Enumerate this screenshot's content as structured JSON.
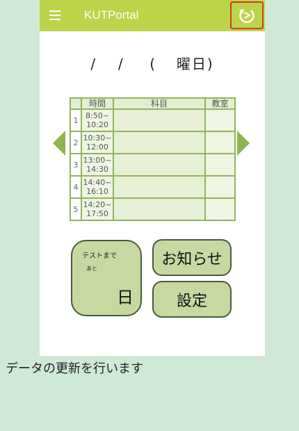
{
  "appbar": {
    "title": "KUTPortal",
    "menu_icon": "hamburger-menu-icon",
    "refresh_icon": "refresh-icon",
    "color": "#bcd44a"
  },
  "date": {
    "sep1": "/",
    "sep2": "/",
    "open_paren": "(",
    "weekday_suffix": "曜日)"
  },
  "timetable": {
    "headers": [
      "",
      "時間",
      "科目",
      "教室"
    ],
    "rows": [
      {
        "num": "1",
        "start": "8:50~",
        "end": "10:20",
        "subject": "",
        "room": ""
      },
      {
        "num": "2",
        "start": "10:30~",
        "end": "12:00",
        "subject": "",
        "room": ""
      },
      {
        "num": "3",
        "start": "13:00~",
        "end": "14:30",
        "subject": "",
        "room": ""
      },
      {
        "num": "4",
        "start": "14:40~",
        "end": "16:10",
        "subject": "",
        "room": ""
      },
      {
        "num": "5",
        "start": "14:20~",
        "end": "17:50",
        "subject": "",
        "room": ""
      }
    ]
  },
  "nav": {
    "prev_icon": "left-arrow-icon",
    "next_icon": "right-arrow-icon"
  },
  "test_countdown": {
    "label": "テストまで",
    "sub": "あと",
    "days_suffix": "日"
  },
  "buttons": {
    "news": "お知らせ",
    "settings": "設定"
  },
  "status_text": "データの更新を行います",
  "colors": {
    "accent": "#bcd44a",
    "highlight": "#d43a2a",
    "panel": "#c7d9a1",
    "background": "#cfe9d6"
  }
}
